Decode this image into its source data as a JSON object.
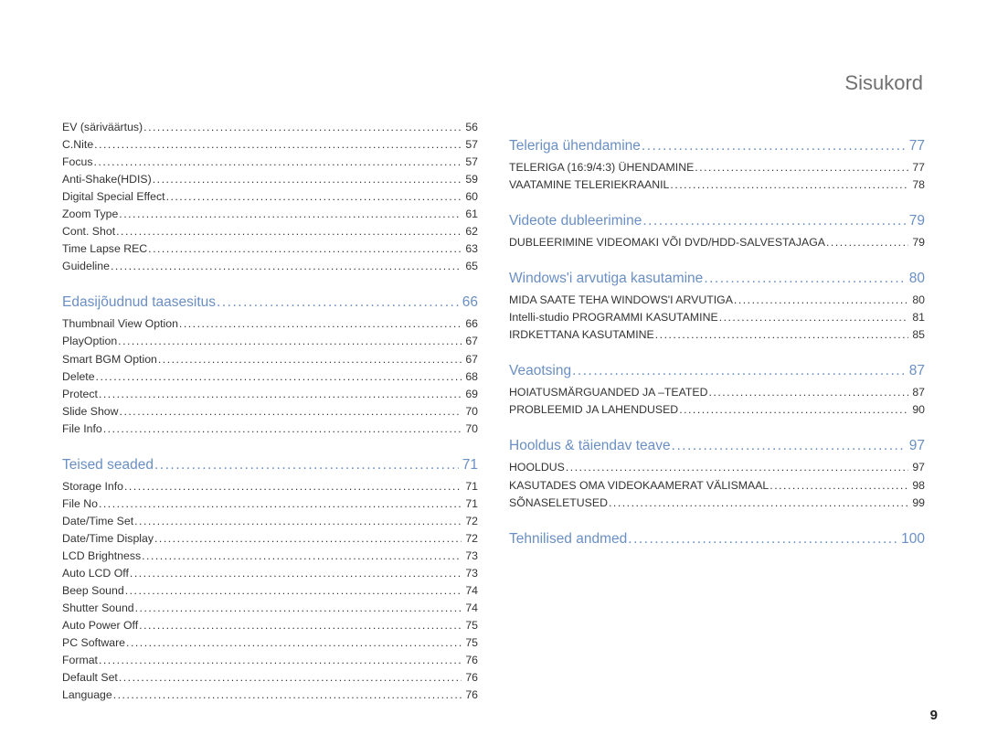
{
  "title": "Sisukord",
  "page_number": "9",
  "left": [
    {
      "type": "entry",
      "label": "EV (säriväärtus)",
      "page": "56"
    },
    {
      "type": "entry",
      "label": "C.Nite",
      "page": "57"
    },
    {
      "type": "entry",
      "label": "Focus",
      "page": "57"
    },
    {
      "type": "entry",
      "label": "Anti-Shake(HDIS)",
      "page": "59"
    },
    {
      "type": "entry",
      "label": "Digital Special Effect",
      "page": "60"
    },
    {
      "type": "entry",
      "label": "Zoom Type",
      "page": "61"
    },
    {
      "type": "entry",
      "label": "Cont. Shot",
      "page": "62"
    },
    {
      "type": "entry",
      "label": "Time Lapse REC",
      "page": "63"
    },
    {
      "type": "entry",
      "label": "Guideline",
      "page": "65"
    },
    {
      "type": "section",
      "label": "Edasijõudnud taasesitus",
      "page": "66"
    },
    {
      "type": "entry",
      "label": "Thumbnail View Option",
      "page": "66"
    },
    {
      "type": "entry",
      "label": "PlayOption",
      "page": "67"
    },
    {
      "type": "entry",
      "label": "Smart BGM Option",
      "page": "67"
    },
    {
      "type": "entry",
      "label": "Delete",
      "page": "68"
    },
    {
      "type": "entry",
      "label": "Protect",
      "page": "69"
    },
    {
      "type": "entry",
      "label": "Slide Show",
      "page": "70"
    },
    {
      "type": "entry",
      "label": "File Info",
      "page": "70"
    },
    {
      "type": "section",
      "label": "Teised seaded",
      "page": "71"
    },
    {
      "type": "entry",
      "label": "Storage Info",
      "page": "71"
    },
    {
      "type": "entry",
      "label": "File No",
      "page": "71"
    },
    {
      "type": "entry",
      "label": "Date/Time Set",
      "page": "72"
    },
    {
      "type": "entry",
      "label": "Date/Time Display",
      "page": "72"
    },
    {
      "type": "entry",
      "label": "LCD Brightness",
      "page": "73"
    },
    {
      "type": "entry",
      "label": "Auto LCD Off",
      "page": "73"
    },
    {
      "type": "entry",
      "label": "Beep Sound",
      "page": "74"
    },
    {
      "type": "entry",
      "label": "Shutter Sound",
      "page": "74"
    },
    {
      "type": "entry",
      "label": "Auto Power Off",
      "page": "75"
    },
    {
      "type": "entry",
      "label": "PC Software",
      "page": "75"
    },
    {
      "type": "entry",
      "label": "Format",
      "page": "76"
    },
    {
      "type": "entry",
      "label": "Default Set",
      "page": "76"
    },
    {
      "type": "entry",
      "label": "Language",
      "page": "76"
    }
  ],
  "right": [
    {
      "type": "section",
      "label": "Teleriga ühendamine",
      "page": "77"
    },
    {
      "type": "entry",
      "label": "TELERIGA (16:9/4:3) ÜHENDAMINE",
      "page": "77"
    },
    {
      "type": "entry",
      "label": "VAATAMINE TELERIEKRAANIL",
      "page": "78"
    },
    {
      "type": "section",
      "label": "Videote dubleerimine",
      "page": "79"
    },
    {
      "type": "entry",
      "label": "DUBLEERIMINE VIDEOMAKI VÕI DVD/HDD-SALVESTAJAGA",
      "page": "79"
    },
    {
      "type": "section",
      "label": "Windows'i arvutiga kasutamine",
      "page": "80"
    },
    {
      "type": "entry",
      "label": "MIDA SAATE TEHA WINDOWS'I ARVUTIGA",
      "page": "80"
    },
    {
      "type": "entry",
      "label": "Intelli-studio PROGRAMMI KASUTAMINE",
      "page": "81"
    },
    {
      "type": "entry",
      "label": "IRDKETTANA KASUTAMINE",
      "page": "85"
    },
    {
      "type": "section",
      "label": "Veaotsing",
      "page": "87"
    },
    {
      "type": "entry",
      "label": "HOIATUSMÄRGUANDED JA –TEATED",
      "page": "87"
    },
    {
      "type": "entry",
      "label": "PROBLEEMID JA LAHENDUSED",
      "page": "90"
    },
    {
      "type": "section",
      "label": "Hooldus & täiendav teave",
      "page": "97"
    },
    {
      "type": "entry",
      "label": "HOOLDUS",
      "page": "97"
    },
    {
      "type": "entry",
      "label": "KASUTADES OMA VIDEOKAAMERAT VÄLISMAAL",
      "page": "98"
    },
    {
      "type": "entry",
      "label": "SÕNASELETUSED",
      "page": "99"
    },
    {
      "type": "section",
      "label": "Tehnilised andmed",
      "page": "100"
    }
  ]
}
